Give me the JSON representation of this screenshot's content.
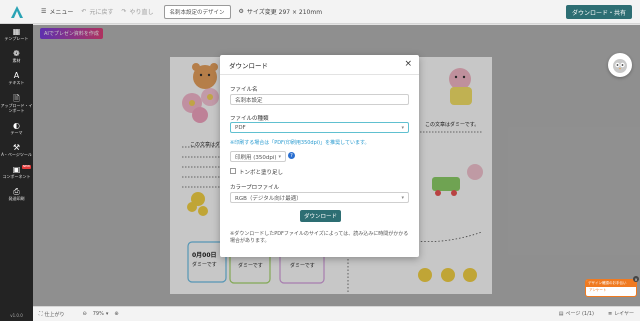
{
  "topbar": {
    "menu_label": "メニュー",
    "undo_label": "元に戻す",
    "redo_label": "やり直し",
    "design_button": "名刺本設定のデザイン",
    "size_label": "サイズ変更 297 × 210mm",
    "download_share_label": "ダウンロード・共有"
  },
  "ai_button_label": "AIでプレゼン資料を作成",
  "sidebar": {
    "items": [
      {
        "label": "テンプレート",
        "icon": "grid-icon"
      },
      {
        "label": "素材",
        "icon": "shapes-icon"
      },
      {
        "label": "テキスト",
        "icon": "text-icon"
      },
      {
        "label": "アップロード・インポート",
        "icon": "upload-icon"
      },
      {
        "label": "テーマ",
        "icon": "palette-icon"
      },
      {
        "label": "A・ページツール",
        "icon": "tools-icon"
      },
      {
        "label": "コンポーネント",
        "icon": "components-icon",
        "badge": "NEW"
      },
      {
        "label": "発送印刷",
        "icon": "printer-icon"
      }
    ],
    "version": "v1.0.0"
  },
  "canvas_texts": {
    "dummy_right": "この文章はダミーです。",
    "dummy_left": "この文章はダミーです。",
    "date": "0月00日",
    "dummy_card1": "ダミーです",
    "dummy_card2": "ダミーです",
    "dummy_card3": "ダミーです"
  },
  "modal": {
    "title": "ダウンロード",
    "file_name_label": "ファイル名",
    "file_name_value": "名刺本設定",
    "file_type_label": "ファイルの種類",
    "file_type_value": "PDF",
    "print_note": "※印刷する場合は「PDF(印刷用350dpi)」を推奨しています。",
    "quality_value": "印刷用 (350dpi)",
    "crop_marks_label": "トンボと塗り足し",
    "color_profile_label": "カラープロファイル",
    "color_profile_value": "RGB（デジタル向け最適）",
    "download_button": "ダウンロード",
    "footer_note": "※ダウンロードしたPDFファイルのサイズによっては、読み込みに時間がかかる場合があります。"
  },
  "bottombar": {
    "fit_label": "仕上がり",
    "zoom_value": "79%",
    "page_label": "ページ (1/1)",
    "layer_label": "レイヤー"
  },
  "promo": {
    "top_text": "デザイン確認のお手伝い",
    "body_text": "アンケート"
  },
  "colors": {
    "accent": "#2d6e73",
    "sidebar": "#232323"
  }
}
